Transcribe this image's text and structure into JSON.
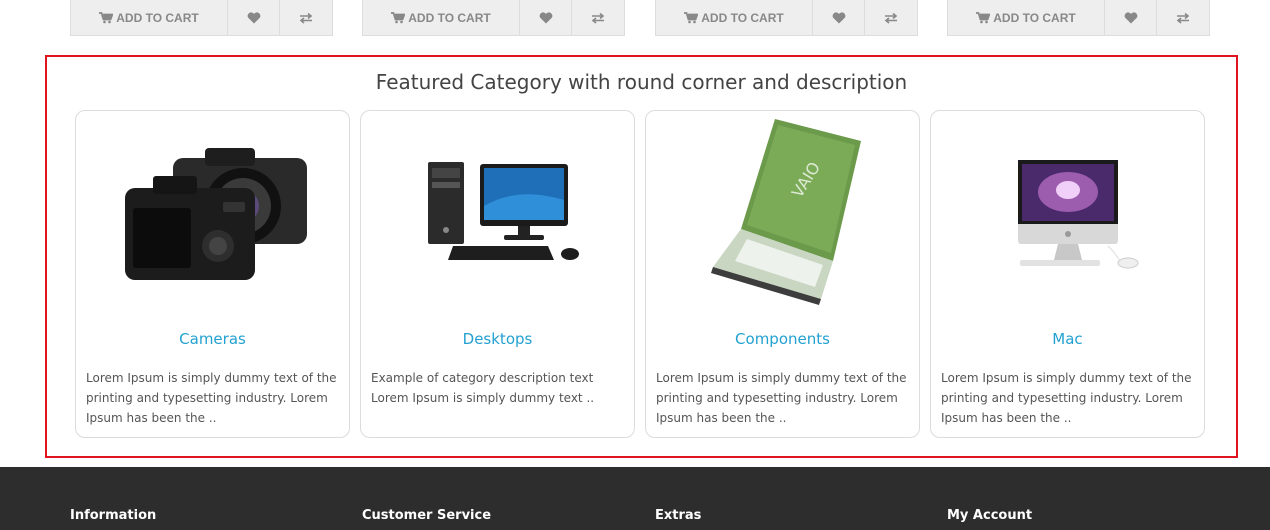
{
  "product_buttons": {
    "cart_label": "ADD TO CART",
    "wishlist_icon": "heart-icon",
    "compare_icon": "exchange-icon"
  },
  "featured": {
    "title": "Featured Category with round corner and description",
    "border_color": "#e0141e",
    "link_color": "#23a1d1",
    "categories": [
      {
        "name": "Cameras",
        "image": "camera-image",
        "description": "Lorem Ipsum is simply dummy text of the printing and typesetting industry. Lorem Ipsum has been the .."
      },
      {
        "name": "Desktops",
        "image": "desktop-computer-image",
        "description": "Example of category description text Lorem Ipsum is simply dummy text .."
      },
      {
        "name": "Components",
        "image": "laptop-image",
        "description": "Lorem Ipsum is simply dummy text of the printing and typesetting industry. Lorem Ipsum has been the .."
      },
      {
        "name": "Mac",
        "image": "imac-image",
        "description": "Lorem Ipsum is simply dummy text of the printing and typesetting industry. Lorem Ipsum has been the .."
      }
    ]
  },
  "footer": {
    "background": "#2d2d2d",
    "headings": [
      "Information",
      "Customer Service",
      "Extras",
      "My Account"
    ]
  }
}
